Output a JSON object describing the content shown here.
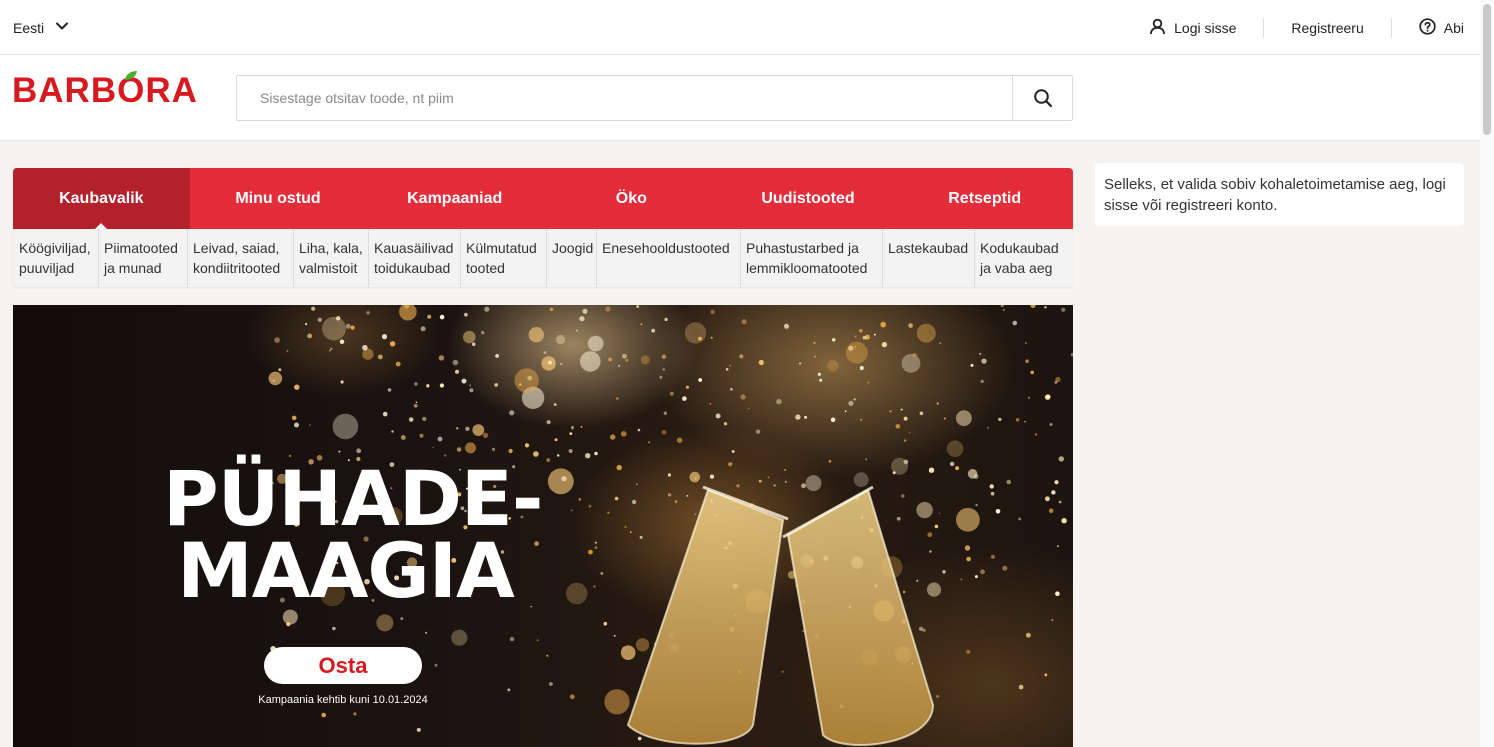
{
  "topbar": {
    "language": "Eesti",
    "login": "Logi sisse",
    "register": "Registreeru",
    "help": "Abi"
  },
  "header": {
    "logo": "BARBORA",
    "search_placeholder": "Sisestage otsitav toode, nt piim"
  },
  "nav": {
    "tabs": [
      {
        "label": "Kaubavalik",
        "active": true
      },
      {
        "label": "Minu ostud"
      },
      {
        "label": "Kampaaniad"
      },
      {
        "label": "Öko"
      },
      {
        "label": "Uudistooted"
      },
      {
        "label": "Retseptid"
      }
    ]
  },
  "subcategories": [
    "Köögiviljad,\npuuviljad",
    "Piimatooted\nja munad",
    "Leivad, saiad,\nkondiitritooted",
    "Liha, kala,\nvalmistoit",
    "Kauasäilivad\ntoidukaubad",
    "Külmutatud\ntooted",
    "Joogid",
    "Enesehooldustooted",
    "Puhastustarbed ja\nlemmikloomatooted",
    "Lastekaubad",
    "Kodukaubad\nja vaba aeg"
  ],
  "banner": {
    "title_line1": "PÜHADE-",
    "title_line2": "MAAGIA",
    "button": "Osta",
    "note": "Kampaania kehtib kuni 10.01.2024"
  },
  "delivery": {
    "text": "Selleks, et valida sobiv kohaletoimetamise aeg, logi sisse või registreeri konto."
  },
  "colors": {
    "brand_red": "#d71920",
    "nav_red": "#e32d3a",
    "nav_active": "#b3222c"
  }
}
